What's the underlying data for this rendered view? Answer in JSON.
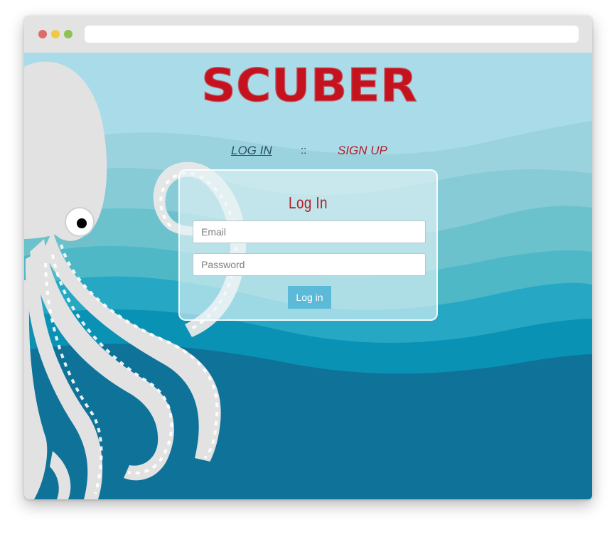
{
  "browser": {
    "dot_colors": [
      "#e06a6b",
      "#f2c947",
      "#8fc351"
    ],
    "address": ""
  },
  "brand": {
    "name": "SCUBER",
    "color": "#c4121f"
  },
  "nav": {
    "login_tab": "LOG IN",
    "separator": "::",
    "signup_tab": "SIGN UP"
  },
  "login_form": {
    "title": "Log In",
    "email_placeholder": "Email",
    "password_placeholder": "Password",
    "submit_label": "Log in"
  },
  "colors": {
    "sky": "#a9dce8",
    "deep_water": "#0f7299",
    "octopus": "#e2e2e2",
    "accent_red": "#b31c26",
    "button": "#5bbad8"
  }
}
